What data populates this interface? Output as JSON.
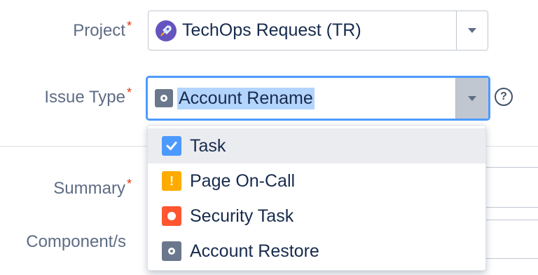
{
  "project": {
    "label": "Project",
    "required_mark": "*",
    "value": "TechOps Request (TR)",
    "icon": "rocket-icon"
  },
  "issue_type": {
    "label": "Issue Type",
    "required_mark": "*",
    "value": "Account Rename",
    "icon": "account-icon",
    "help": "?"
  },
  "summary": {
    "label": "Summary",
    "required_mark": "*"
  },
  "components": {
    "label": "Component/s"
  },
  "dropdown": {
    "options": [
      {
        "label": "Task",
        "icon": "task-check-icon",
        "color": "#4c9aff"
      },
      {
        "label": "Page On-Call",
        "icon": "exclamation-icon",
        "color": "#ffab00",
        "glyph": "!"
      },
      {
        "label": "Security Task",
        "icon": "security-dot-icon",
        "color": "#ff5630"
      },
      {
        "label": "Account Restore",
        "icon": "account-icon",
        "color": "#6b778c"
      }
    ]
  },
  "colors": {
    "accent": "#4c9aff",
    "required": "#de350b",
    "label": "#5e6c84",
    "selection": "#b3d4fc"
  }
}
